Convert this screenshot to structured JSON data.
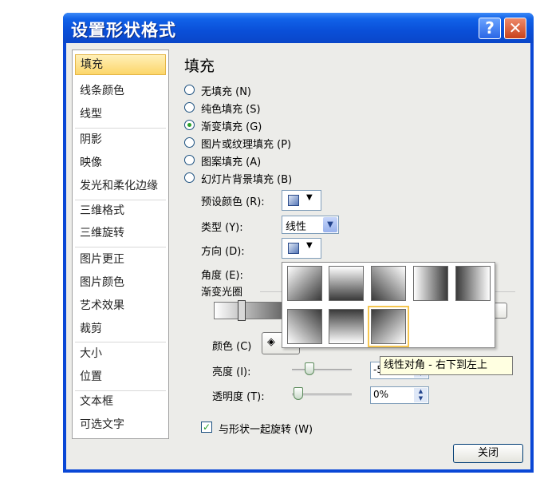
{
  "window": {
    "title": "设置形状格式"
  },
  "sidebar": {
    "items": [
      "填充",
      "线条颜色",
      "线型",
      "阴影",
      "映像",
      "发光和柔化边缘",
      "三维格式",
      "三维旋转",
      "图片更正",
      "图片颜色",
      "艺术效果",
      "裁剪",
      "大小",
      "位置",
      "文本框",
      "可选文字"
    ]
  },
  "main": {
    "heading": "填充",
    "fill_options": [
      "无填充 (N)",
      "纯色填充 (S)",
      "渐变填充 (G)",
      "图片或纹理填充 (P)",
      "图案填充 (A)",
      "幻灯片背景填充 (B)"
    ],
    "selected_fill_index": 2,
    "preset_label": "预设颜色 (R):",
    "type_label": "类型 (Y):",
    "type_value": "线性",
    "direction_label": "方向 (D):",
    "angle_label": "角度 (E):",
    "stops_label": "渐变光圈",
    "color_label": "颜色 (C)",
    "brightness_label": "亮度 (I):",
    "brightness_value": "-5",
    "transparency_label": "透明度 (T):",
    "transparency_value": "0%",
    "rotate_label": "与形状一起旋转 (W)",
    "rotate_checked": true
  },
  "tooltip": "线性对角 - 右下到左上",
  "close_label": "关闭",
  "colors": {
    "titlebar": "#0a4fd8",
    "selection": "#fcd66a",
    "accent_green": "#2aa02a"
  }
}
